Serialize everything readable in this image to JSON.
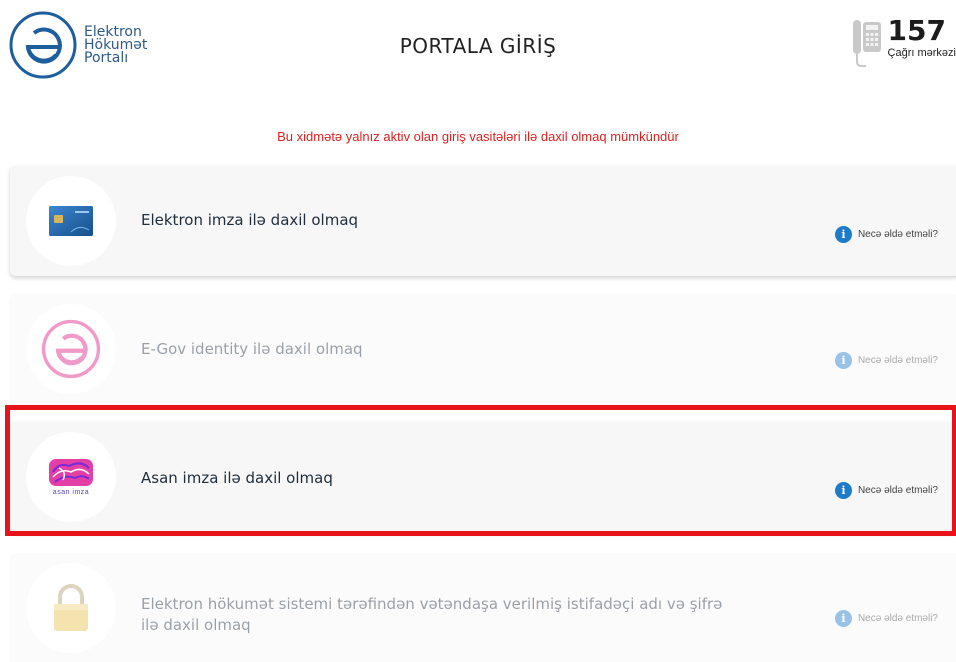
{
  "header": {
    "logo_lines": [
      "Elektron",
      "Hökumət",
      "Portalı"
    ],
    "title": "PORTALA GİRİŞ",
    "call_center": {
      "number": "157",
      "label": "Çağrı mərkəzi"
    }
  },
  "notice": "Bu xidmətə yalnız aktiv olan giriş vasitələri ilə daxil olmaq mümkündür",
  "options": [
    {
      "label": "Elektron imza ilə daxil olmaq",
      "help": "Necə əldə etməli?",
      "icon": "e-signature-card-icon",
      "enabled": true
    },
    {
      "label": "E-Gov identity ilə daxil olmaq",
      "help": "Necə əldə etməli?",
      "icon": "egov-logo-icon",
      "enabled": false
    },
    {
      "label": "Asan imza ilə daxil olmaq",
      "help": "Necə əldə etməli?",
      "icon": "asan-imza-logo-icon",
      "icon_text": "asan imza",
      "enabled": true,
      "highlighted": true
    },
    {
      "label_line1": "Elektron hökumət sistemi tərəfindən vətəndaşa verilmiş istifadəçi adı və şifrə",
      "label_line2": "ilə daxil olmaq",
      "help": "Necə əldə etməli?",
      "icon": "padlock-icon",
      "enabled": false
    }
  ],
  "colors": {
    "notice_red": "#e02020",
    "highlight_red": "#e8121a",
    "info_blue": "#1e7bc8",
    "logo_blue": "#2e5a8a"
  }
}
